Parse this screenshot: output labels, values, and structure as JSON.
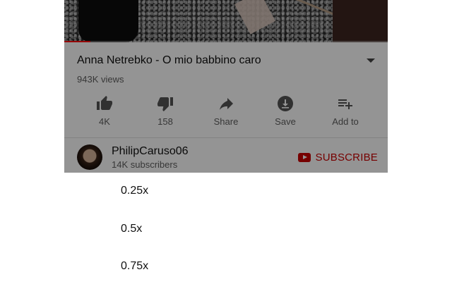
{
  "video": {
    "title": "Anna Netrebko - O mio babbino caro",
    "views": "943K views",
    "progress": 0.08
  },
  "actions": [
    {
      "icon": "thumbs-up-icon",
      "label": "4K"
    },
    {
      "icon": "thumbs-down-icon",
      "label": "158"
    },
    {
      "icon": "share-icon",
      "label": "Share"
    },
    {
      "icon": "download-icon",
      "label": "Save"
    },
    {
      "icon": "playlist-add-icon",
      "label": "Add to"
    }
  ],
  "channel": {
    "name": "PhilipCaruso06",
    "subscribers": "14K subscribers",
    "subscribe_label": "SUBSCRIBE"
  },
  "speed_menu": {
    "options": [
      "0.25x",
      "0.5x",
      "0.75x"
    ]
  },
  "colors": {
    "brand_red": "#cc0000",
    "progress_red": "#ff0000"
  }
}
